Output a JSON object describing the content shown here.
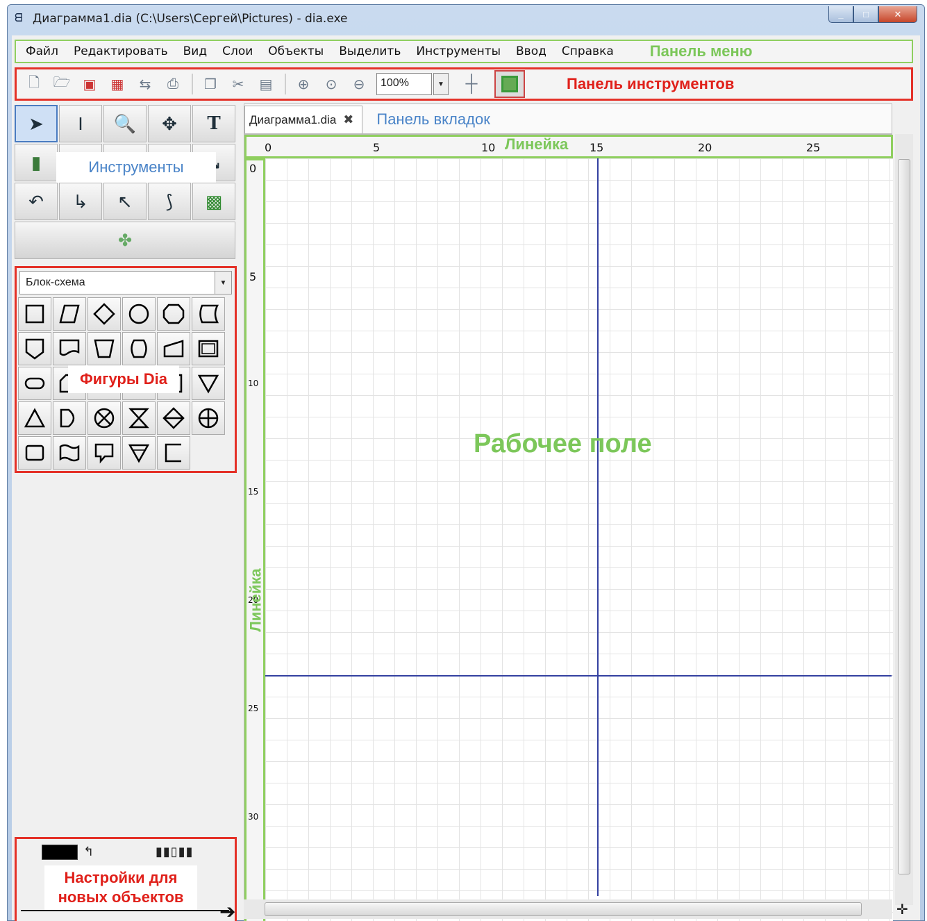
{
  "window": {
    "title": "Диаграмма1.dia (C:\\Users\\Сергей\\Pictures) - dia.exe",
    "controls": [
      "_",
      "□",
      "✕"
    ]
  },
  "menubar": {
    "items": [
      "Файл",
      "Редактировать",
      "Вид",
      "Слои",
      "Объекты",
      "Выделить",
      "Инструменты",
      "Ввод",
      "Справка"
    ],
    "annotation": "Панель меню"
  },
  "toolbar": {
    "zoom_value": "100%",
    "annotation": "Панель инструментов",
    "icons": [
      "new-icon",
      "open-icon",
      "save-icon",
      "save-as-icon",
      "export-icon",
      "print-icon",
      "copy-icon",
      "cut-icon",
      "paste-icon",
      "zoom-in-icon",
      "zoom-fit-icon",
      "zoom-out-icon"
    ]
  },
  "toolbox": {
    "annotation": "Инструменты",
    "tools_row1": [
      "pointer-icon",
      "text-cursor-icon",
      "magnify-icon",
      "move-icon",
      "text-tool-icon"
    ],
    "tools_row3": [
      "arc-icon",
      "zigzag-icon",
      "polyline-icon",
      "bezier-icon",
      "image-icon"
    ]
  },
  "shapes": {
    "selected_sheet": "Блок-схема",
    "annotation": "Фигуры Dia"
  },
  "settings": {
    "annotation_line1": "Настройки для",
    "annotation_line2": "новых объектов"
  },
  "tabs": {
    "active_tab": "Диаграмма1.dia",
    "annotation": "Панель вкладок"
  },
  "canvas": {
    "annotation": "Рабочее поле",
    "ruler_annotation": "Линейка",
    "hruler_labels": [
      "0",
      "5",
      "10",
      "15",
      "20",
      "25"
    ],
    "vruler_labels": [
      "0",
      "5",
      "10",
      "15",
      "20",
      "25",
      "30"
    ]
  }
}
